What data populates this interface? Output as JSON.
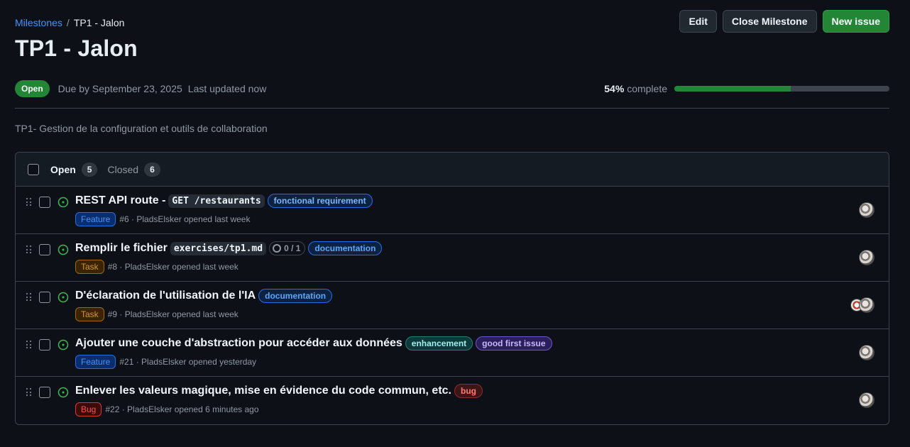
{
  "breadcrumb": {
    "parent": "Milestones",
    "separator": "/",
    "current": "TP1 - Jalon"
  },
  "title": "TP1 - Jalon",
  "actions": {
    "edit": "Edit",
    "close": "Close Milestone",
    "new_issue": "New issue"
  },
  "meta": {
    "state": "Open",
    "due": "Due by September 23, 2025",
    "updated": "Last updated now"
  },
  "progress": {
    "percent_label": "54%",
    "suffix": "complete",
    "value": 0.54
  },
  "description": "TP1- Gestion de la configuration et outils de collaboration",
  "tabs": {
    "open_label": "Open",
    "open_count": "5",
    "closed_label": "Closed",
    "closed_count": "6"
  },
  "colors": {
    "accent_link": "#4493f8",
    "primary": "#238636",
    "open_issue": "#3fb950"
  },
  "issues": [
    {
      "title": "REST API route -",
      "code": "GET /restaurants",
      "tasks": null,
      "labels": [
        {
          "text": "fonctional requirement",
          "fg": "#79b8ff",
          "bg": "#0d2240",
          "border": "#1f6feb"
        }
      ],
      "type": {
        "text": "Feature",
        "fg": "#4493f8",
        "bg": "#0c2d6b",
        "border": "#1f6feb"
      },
      "meta": "#6 · PladsElsker opened last week",
      "avatars": 1
    },
    {
      "title": "Remplir le fichier",
      "code": "exercises/tp1.md",
      "tasks": "0 / 1",
      "labels": [
        {
          "text": "documentation",
          "fg": "#58a6ff",
          "bg": "#0d2240",
          "border": "#1f6feb"
        }
      ],
      "type": {
        "text": "Task",
        "fg": "#d29922",
        "bg": "#3b2300",
        "border": "#9e6a03"
      },
      "meta": "#8 · PladsElsker opened last week",
      "avatars": 1
    },
    {
      "title": "D'éclaration de l'utilisation de l'IA",
      "code": null,
      "tasks": null,
      "labels": [
        {
          "text": "documentation",
          "fg": "#58a6ff",
          "bg": "#0d2240",
          "border": "#1f6feb"
        }
      ],
      "type": {
        "text": "Task",
        "fg": "#d29922",
        "bg": "#3b2300",
        "border": "#9e6a03"
      },
      "meta": "#9 · PladsElsker opened last week",
      "avatars": 2
    },
    {
      "title": "Ajouter une couche d'abstraction pour accéder aux données",
      "code": null,
      "tasks": null,
      "labels": [
        {
          "text": "enhancement",
          "fg": "#a2eeef",
          "bg": "#0d3a3a",
          "border": "#2a7a7a"
        },
        {
          "text": "good first issue",
          "fg": "#c4b5fd",
          "bg": "#2a1f5a",
          "border": "#6e57d2"
        }
      ],
      "type": {
        "text": "Feature",
        "fg": "#4493f8",
        "bg": "#0c2d6b",
        "border": "#1f6feb"
      },
      "meta": "#21 · PladsElsker opened yesterday",
      "avatars": 1
    },
    {
      "title": "Enlever les valeurs magique, mise en évidence du code commun, etc.",
      "code": null,
      "tasks": null,
      "labels": [
        {
          "text": "bug",
          "fg": "#ff7b72",
          "bg": "#3d1517",
          "border": "#8e2b2b"
        }
      ],
      "type": {
        "text": "Bug",
        "fg": "#f85149",
        "bg": "#3d0a0a",
        "border": "#da3633"
      },
      "meta": "#22 · PladsElsker opened 6 minutes ago",
      "avatars": 1
    }
  ]
}
